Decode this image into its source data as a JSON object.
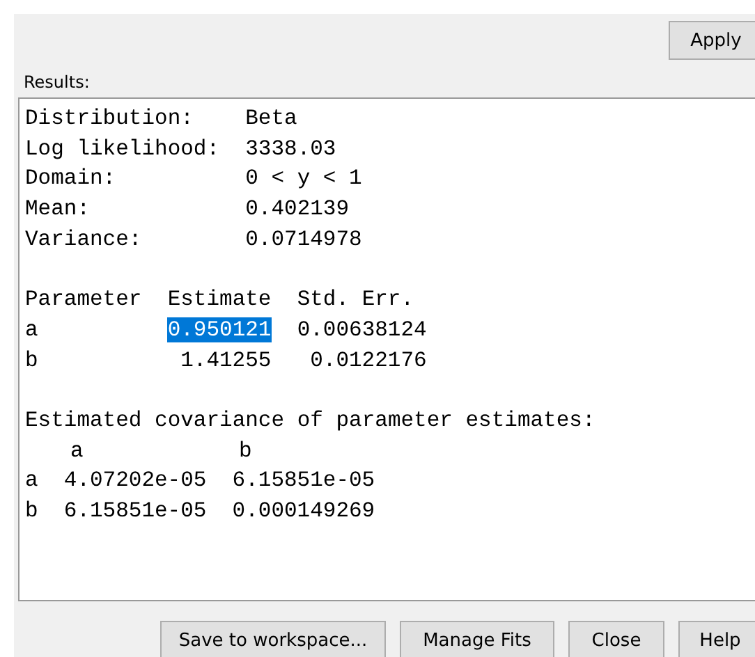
{
  "apply_button": "Apply",
  "results_label": "Results:",
  "summary": [
    {
      "label": "Distribution:",
      "value": "Beta"
    },
    {
      "label": "Log likelihood:",
      "value": "3338.03"
    },
    {
      "label": "Domain:",
      "value": "0 < y < 1"
    },
    {
      "label": "Mean:",
      "value": "0.402139"
    },
    {
      "label": "Variance:",
      "value": "0.0714978"
    }
  ],
  "parameters": {
    "columns": [
      "Parameter",
      "Estimate",
      "Std. Err."
    ],
    "rows": [
      {
        "name": "a",
        "estimate": "0.950121",
        "estimate_selected": true,
        "std_err": "0.00638124"
      },
      {
        "name": "b",
        "estimate": "1.41255",
        "estimate_selected": false,
        "std_err": "0.0122176"
      }
    ]
  },
  "covariance": {
    "title": "Estimated covariance of parameter estimates:",
    "columns": [
      "a",
      "b"
    ],
    "rows": [
      {
        "name": "a",
        "values": [
          "4.07202e-05",
          "6.15851e-05"
        ]
      },
      {
        "name": "b",
        "values": [
          "6.15851e-05",
          "0.000149269"
        ]
      }
    ]
  },
  "buttons": [
    "Save to workspace...",
    "Manage Fits",
    "Close",
    "Help"
  ]
}
